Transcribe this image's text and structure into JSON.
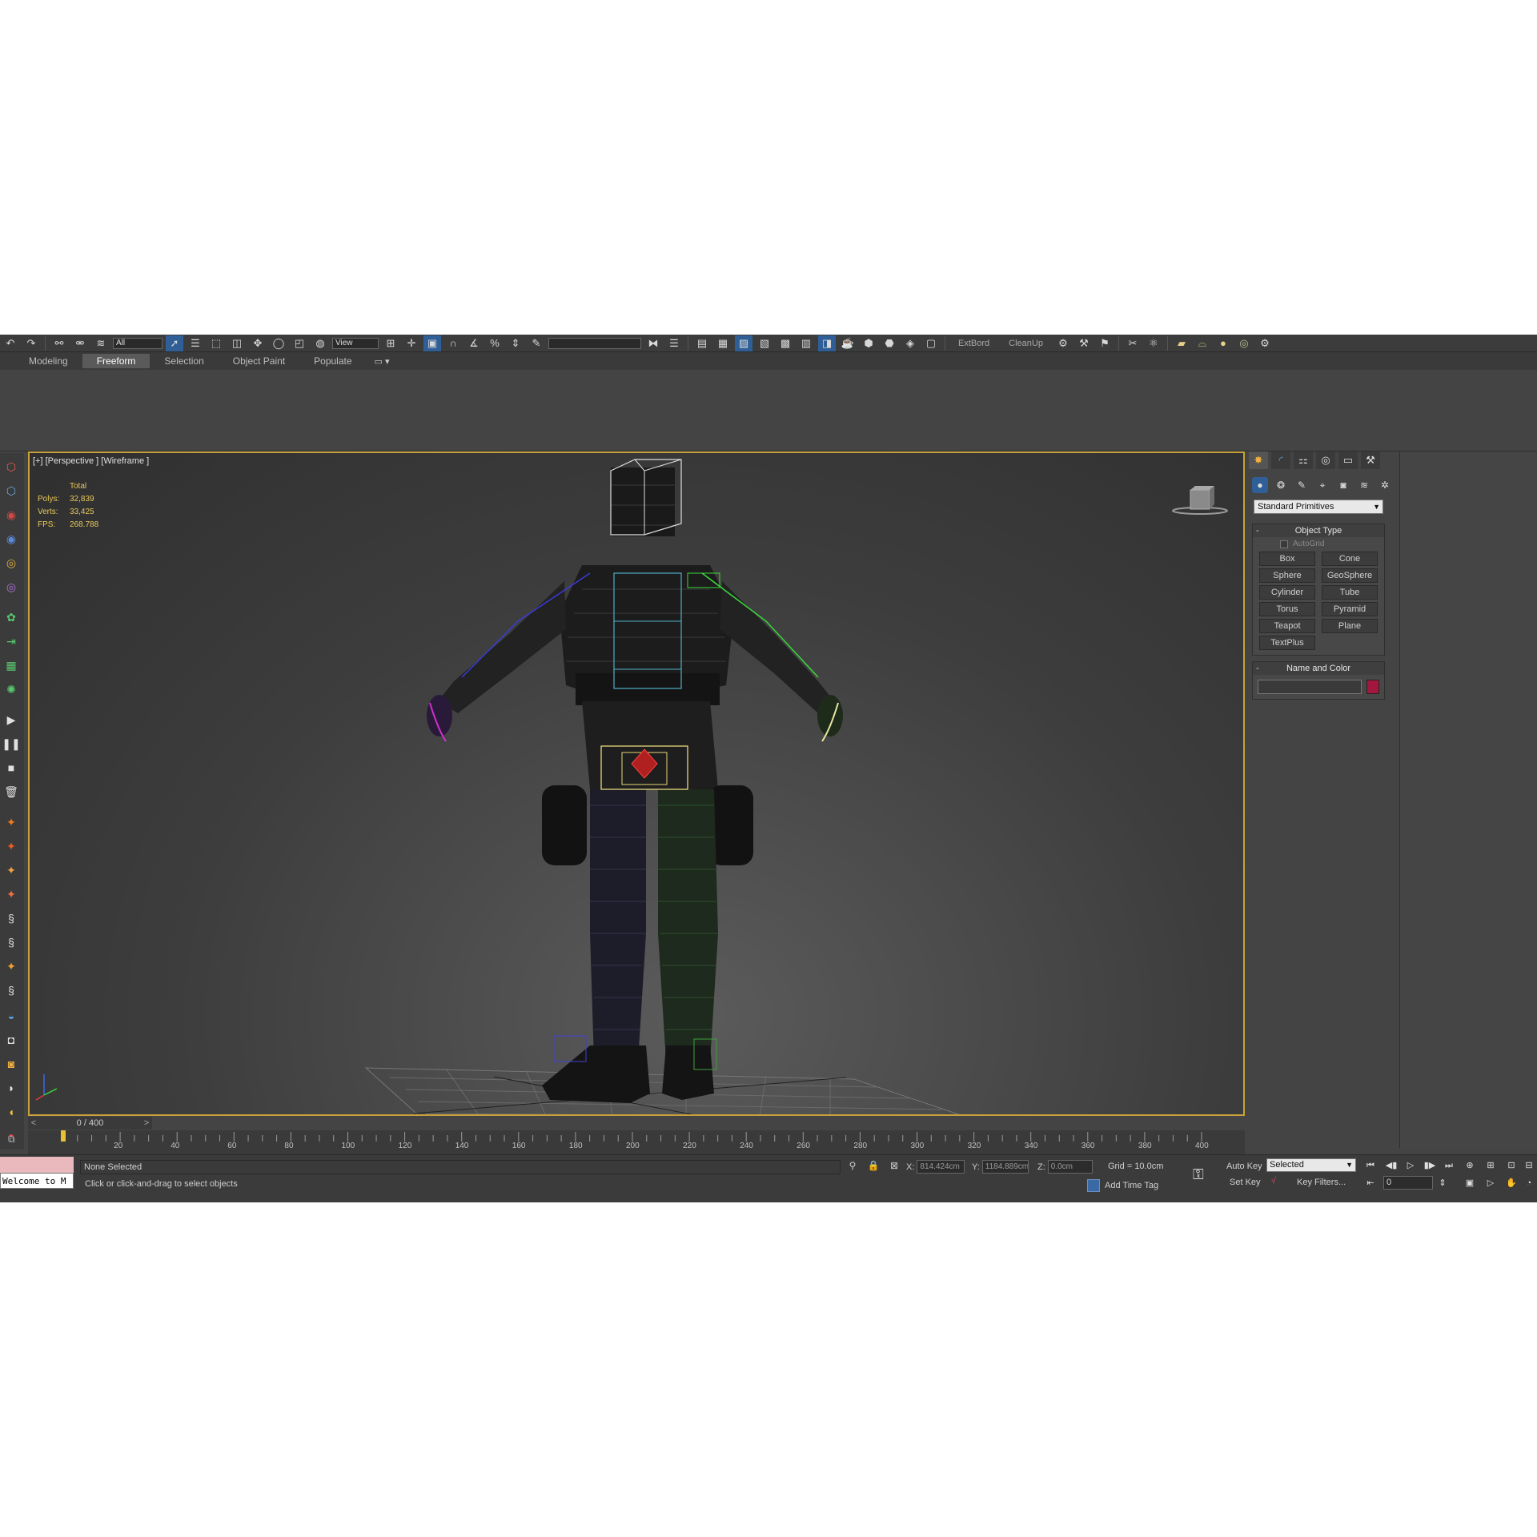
{
  "toolbar": {
    "field1": "All",
    "field2": "View",
    "extbord": "ExtBord",
    "cleanup": "CleanUp",
    "named_sel": ""
  },
  "ribbon": {
    "tabs": [
      "Modeling",
      "Freeform",
      "Selection",
      "Object Paint",
      "Populate"
    ],
    "active_tab": "Freeform"
  },
  "viewport": {
    "label": "[+] [Perspective ] [Wireframe ]",
    "stats": {
      "header": "Total",
      "polys_label": "Polys:",
      "polys": "32,839",
      "verts_label": "Verts:",
      "verts": "33,425",
      "fps_label": "FPS:",
      "fps": "268.788"
    }
  },
  "time_slider": {
    "prev": "<",
    "value": "0 / 400",
    "next": ">"
  },
  "timeline": {
    "ticks": [
      "20",
      "40",
      "60",
      "80",
      "100",
      "120",
      "140",
      "160",
      "180",
      "200",
      "220",
      "240",
      "260",
      "280",
      "300",
      "320",
      "340",
      "360",
      "380",
      "400"
    ]
  },
  "command_panel": {
    "category": "Standard Primitives",
    "object_type": {
      "title": "Object Type",
      "autogrid": "AutoGrid",
      "buttons": [
        "Box",
        "Cone",
        "Sphere",
        "GeoSphere",
        "Cylinder",
        "Tube",
        "Torus",
        "Pyramid",
        "Teapot",
        "Plane",
        "TextPlus"
      ]
    },
    "name_color": {
      "title": "Name and Color",
      "name": "",
      "color": "#a3173f"
    }
  },
  "status": {
    "maxscript": "Welcome to M",
    "selection": "None Selected",
    "prompt": "Click or click-and-drag to select objects",
    "x_label": "X:",
    "x": "814.424cm",
    "y_label": "Y:",
    "y": "1184.889cm",
    "z_label": "Z:",
    "z": "0.0cm",
    "grid": "Grid = 10.0cm",
    "add_time_tag": "Add Time Tag",
    "auto_key": "Auto Key",
    "set_key": "Set Key",
    "key_mode": "Selected",
    "key_filters": "Key Filters...",
    "frame": "0"
  },
  "colors": {
    "accent": "#c8a13a",
    "highlight": "#2f5f96",
    "background": "#444444"
  }
}
